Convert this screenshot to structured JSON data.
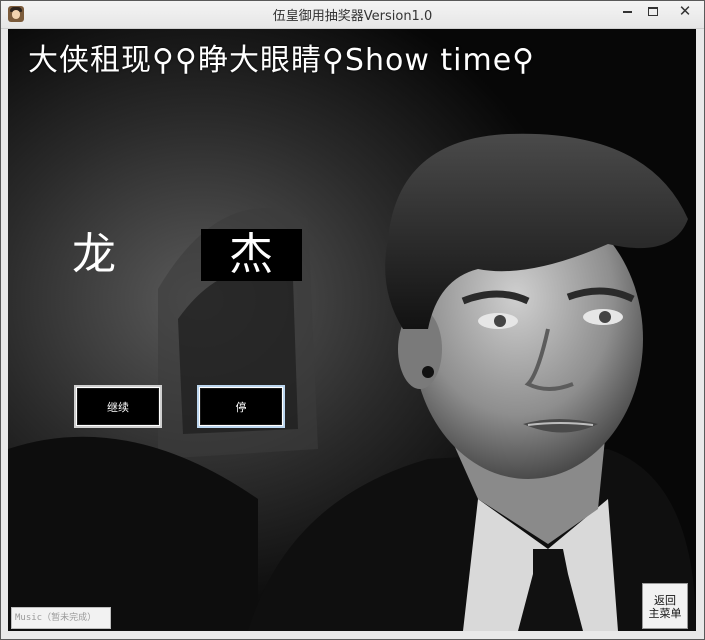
{
  "window": {
    "title": "伍皇御用抽奖器Version1.0",
    "close_glyph": "✕"
  },
  "banner": {
    "text": "大侠租现⚲⚲睁大眼睛⚲Show time⚲"
  },
  "draw": {
    "name_part_1": "龙",
    "name_part_2": "杰"
  },
  "buttons": {
    "continue_label": "继续",
    "stop_label": "停",
    "return_label_line1": "返回",
    "return_label_line2": "主菜单",
    "music_label": "Music（暂未完成）"
  },
  "icons": {
    "app": "avatar-icon",
    "minimize": "minimize-icon",
    "maximize": "maximize-icon",
    "close": "close-icon"
  }
}
